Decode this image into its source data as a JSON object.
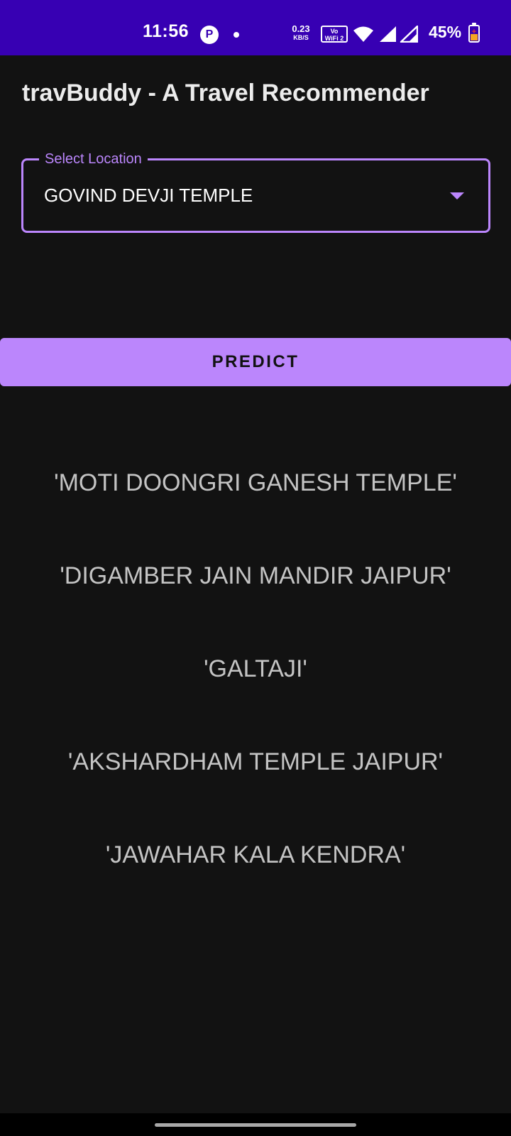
{
  "status_bar": {
    "time": "11:56",
    "app_icon_glyph": "P",
    "net_speed_value": "0.23",
    "net_speed_unit": "KB/S",
    "volte_line1": "Vo",
    "volte_line2": "WiFi 2",
    "battery_percent": "45%",
    "battery_level": 0.45,
    "icons": [
      "notification-app-icon",
      "notification-dot-icon",
      "volte-icon",
      "wifi-icon",
      "signal-icon",
      "signal-icon",
      "battery-charging-icon"
    ]
  },
  "app": {
    "title": "travBuddy - A Travel Recommender"
  },
  "location_select": {
    "label": "Select Location",
    "value": "GOVIND DEVJI TEMPLE",
    "icon": "dropdown-arrow-icon"
  },
  "predict_button": {
    "label": "PREDICT"
  },
  "results": [
    "'MOTI DOONGRI GANESH TEMPLE'",
    "'DIGAMBER JAIN MANDIR JAIPUR'",
    "'GALTAJI'",
    "'AKSHARDHAM TEMPLE JAIPUR'",
    "'JAWAHAR KALA KENDRA'"
  ],
  "colors": {
    "status_bar": "#3700b3",
    "background": "#121212",
    "accent": "#bb86fc",
    "result_text": "#c4c4c4"
  }
}
